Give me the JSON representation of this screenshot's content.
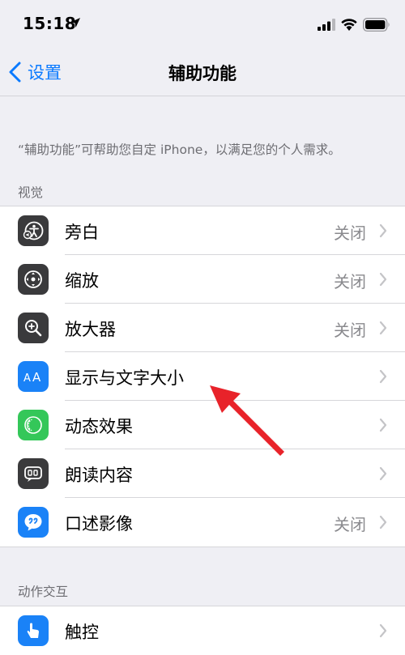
{
  "status_bar": {
    "time": "15:18"
  },
  "nav": {
    "back_label": "设置",
    "title": "辅助功能"
  },
  "description": "“辅助功能”可帮助您自定 iPhone，以满足您的个人需求。",
  "sections": [
    {
      "header": "视觉",
      "items": [
        {
          "label": "旁白",
          "value": "关闭",
          "icon": "voiceover-icon",
          "color": "#3a3a3c"
        },
        {
          "label": "缩放",
          "value": "关闭",
          "icon": "zoom-icon",
          "color": "#3a3a3c"
        },
        {
          "label": "放大器",
          "value": "关闭",
          "icon": "magnifier-icon",
          "color": "#3a3a3c"
        },
        {
          "label": "显示与文字大小",
          "value": "",
          "icon": "text-size-icon",
          "color": "#1a82f7"
        },
        {
          "label": "动态效果",
          "value": "",
          "icon": "motion-icon",
          "color": "#34c759"
        },
        {
          "label": "朗读内容",
          "value": "",
          "icon": "spoken-content-icon",
          "color": "#3a3a3c"
        },
        {
          "label": "口述影像",
          "value": "关闭",
          "icon": "audio-description-icon",
          "color": "#1a82f7"
        }
      ]
    },
    {
      "header": "动作交互",
      "items": [
        {
          "label": "触控",
          "value": "",
          "icon": "touch-icon",
          "color": "#1a82f7"
        }
      ]
    }
  ],
  "annotation": {
    "type": "arrow",
    "color": "#e8232a",
    "points_to": "显示与文字大小"
  }
}
